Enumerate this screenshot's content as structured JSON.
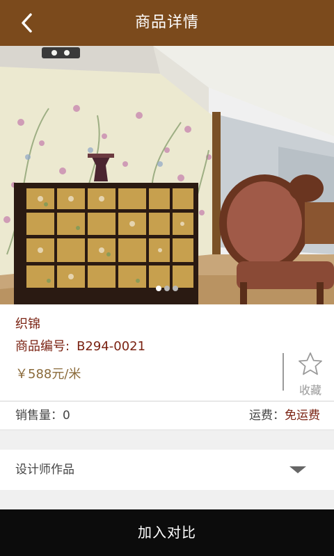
{
  "header": {
    "title": "商品详情",
    "back_icon": "chevron-left-icon"
  },
  "carousel": {
    "slide_count": 3,
    "active_index": 0
  },
  "product": {
    "name": "织锦",
    "code_label": "商品编号:",
    "code_value": "B294-0021",
    "price": "￥588元/米"
  },
  "favorite": {
    "icon": "star-outline-icon",
    "label": "收藏"
  },
  "sales": {
    "label": "销售量：0",
    "shipping_label": "运费：",
    "shipping_value": "免运费"
  },
  "designer": {
    "label": "设计师作品",
    "icon": "dropdown-arrow-icon"
  },
  "bottom_button": {
    "label": "加入对比"
  },
  "colors": {
    "header_bg": "#7b4a1c",
    "accent_text": "#7a2212",
    "bottom_bg": "#0c0c0c"
  }
}
